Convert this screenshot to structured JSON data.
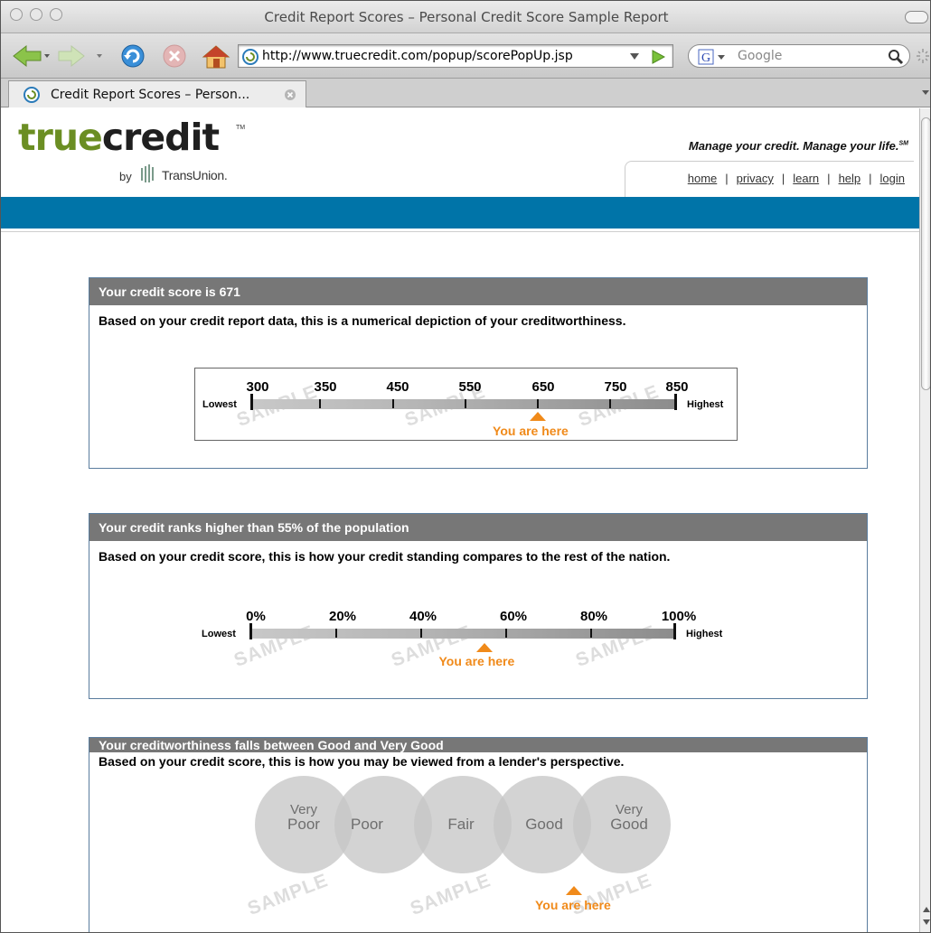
{
  "window": {
    "title": "Credit Report Scores – Personal Credit Score Sample Report"
  },
  "toolbar": {
    "url": "http://www.truecredit.com/popup/scorePopUp.jsp",
    "search_placeholder": "Google"
  },
  "tab": {
    "label": "Credit Report Scores – Person..."
  },
  "site": {
    "logo_part1": "true",
    "logo_part2": "credit",
    "logo_tm": "TM",
    "by": "by",
    "partner": "TransUnion.",
    "tagline": "Manage your credit. Manage your life.",
    "tagline_mark": "SM",
    "nav": [
      "home",
      "privacy",
      "learn",
      "help",
      "login"
    ],
    "nav_separator": "|"
  },
  "watermark": "SAMPLE",
  "score_panel": {
    "title": "Your credit score is 671",
    "subtitle": "Based on your credit report data, this is a numerical depiction of your creditworthiness.",
    "ticks": [
      "300",
      "350",
      "450",
      "550",
      "650",
      "750",
      "850"
    ],
    "low_label": "Lowest",
    "high_label": "Highest",
    "marker_label": "You are here",
    "score": 671,
    "range": [
      300,
      850
    ]
  },
  "rank_panel": {
    "title": "Your credit ranks higher than 55% of the population",
    "subtitle": "Based on your credit score, this is how your credit standing compares to the rest of the nation.",
    "ticks": [
      "0%",
      "20%",
      "40%",
      "60%",
      "80%",
      "100%"
    ],
    "low_label": "Lowest",
    "high_label": "Highest",
    "marker_label": "You are here",
    "percentile": 55
  },
  "worthiness_panel": {
    "title": "Your creditworthiness falls between Good and Very Good",
    "subtitle": "Based on your credit score, this is how you may be viewed from a lender's perspective.",
    "categories": [
      {
        "line1": "Very",
        "line2": "Poor"
      },
      {
        "line1": "",
        "line2": "Poor"
      },
      {
        "line1": "",
        "line2": "Fair"
      },
      {
        "line1": "",
        "line2": "Good"
      },
      {
        "line1": "Very",
        "line2": "Good"
      }
    ],
    "marker_label": "You are here"
  },
  "colors": {
    "accent_blue": "#0074a8",
    "header_gray": "#777777",
    "marker_orange": "#f08a1a",
    "logo_green": "#6b8e23"
  }
}
